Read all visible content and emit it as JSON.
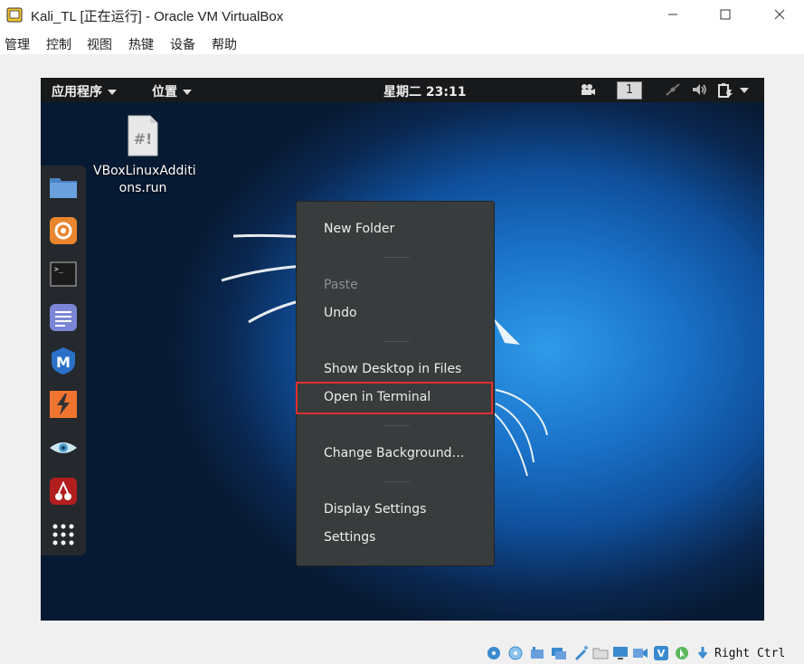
{
  "window": {
    "title": "Kali_TL [正在运行] - Oracle VM VirtualBox",
    "icon": "virtualbox-icon"
  },
  "menubar": {
    "items": [
      "管理",
      "控制",
      "视图",
      "热键",
      "设备",
      "帮助"
    ]
  },
  "guest_topbar": {
    "applications_label": "应用程序",
    "places_label": "位置",
    "clock": "星期二 23:11",
    "workspace_number": "1"
  },
  "desktop": {
    "file_icon_glyph": "#!",
    "file_label_line1": "VBoxLinuxAdditi",
    "file_label_line2": "ons.run"
  },
  "dock": {
    "items": [
      "files-icon",
      "firefox-icon",
      "terminal-icon",
      "text-editor-icon",
      "metasploit-icon",
      "burpsuite-icon",
      "eye-icon",
      "cherry-icon",
      "app-grid-icon"
    ]
  },
  "context_menu": {
    "new_folder": "New Folder",
    "paste": "Paste",
    "undo": "Undo",
    "show_desktop": "Show Desktop in Files",
    "open_terminal": "Open in Terminal",
    "change_background": "Change Background…",
    "display_settings": "Display Settings",
    "settings": "Settings"
  },
  "statusbar": {
    "host_key": "Right Ctrl"
  },
  "colors": {
    "highlight_border": "#e03030",
    "menu_bg": "#383c3c",
    "topbar_bg": "#17191b"
  }
}
